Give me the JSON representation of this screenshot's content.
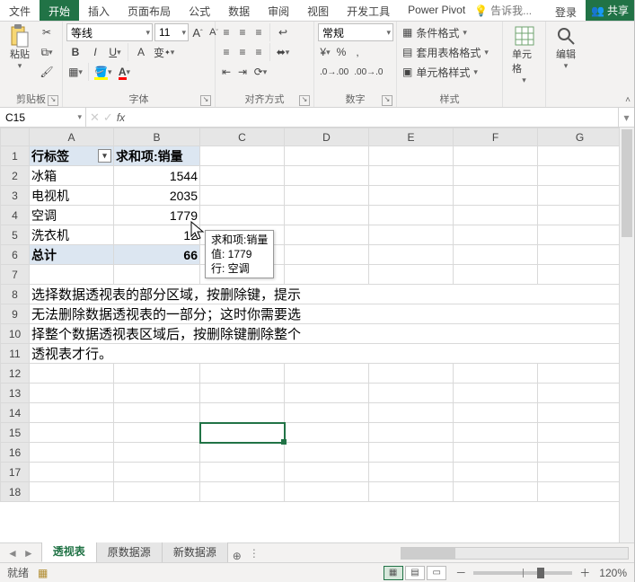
{
  "tabs": {
    "file": "文件",
    "home": "开始",
    "insert": "插入",
    "layout": "页面布局",
    "formulas": "公式",
    "data": "数据",
    "review": "审阅",
    "view": "视图",
    "dev": "开发工具",
    "pp": "Power Pivot",
    "tell": "告诉我...",
    "login": "登录",
    "share": "共享"
  },
  "ribbon": {
    "clipboard": {
      "label": "剪贴板",
      "paste": "粘贴"
    },
    "font": {
      "label": "字体",
      "name": "等线",
      "size": "11"
    },
    "align": {
      "label": "对齐方式"
    },
    "number": {
      "label": "数字",
      "format": "常规"
    },
    "styles": {
      "label": "样式",
      "cond": "条件格式",
      "table": "套用表格格式",
      "cell": "单元格样式"
    },
    "cells": {
      "label": "单元格"
    },
    "editing": {
      "label": "编辑"
    }
  },
  "namebox": "C15",
  "columns": [
    "A",
    "B",
    "C",
    "D",
    "E",
    "F",
    "G"
  ],
  "rows": [
    "1",
    "2",
    "3",
    "4",
    "5",
    "6",
    "7",
    "8",
    "9",
    "10",
    "11",
    "12",
    "13",
    "14",
    "15",
    "16",
    "17",
    "18"
  ],
  "pivot": {
    "rowHeader": "行标签",
    "valHeader": "求和项:销量",
    "items": [
      {
        "label": "冰箱",
        "value": "1544"
      },
      {
        "label": "电视机",
        "value": "2035"
      },
      {
        "label": "空调",
        "value": "1779"
      },
      {
        "label": "洗衣机",
        "value": "12"
      }
    ],
    "totalLabel": "总计",
    "totalValue": "66"
  },
  "note": {
    "l1": "选择数据透视表的部分区域，按删除键，提示",
    "l2": "无法删除数据透视表的一部分；这时你需要选",
    "l3": "择整个数据透视表区域后，按删除键删除整个",
    "l4": "透视表才行。"
  },
  "tooltip": {
    "l1": "求和项:销量",
    "l2": "值: 1779",
    "l3": "行: 空调"
  },
  "sheets": {
    "s1": "透视表",
    "s2": "原数据源",
    "s3": "新数据源"
  },
  "status": {
    "ready": "就绪",
    "zoom": "120%"
  },
  "chart_data": {
    "type": "table",
    "title": "求和项:销量 by 行标签",
    "columns": [
      "行标签",
      "求和项:销量"
    ],
    "rows": [
      [
        "冰箱",
        1544
      ],
      [
        "电视机",
        2035
      ],
      [
        "空调",
        1779
      ],
      [
        "洗衣机",
        null
      ]
    ],
    "total": [
      "总计",
      null
    ]
  }
}
